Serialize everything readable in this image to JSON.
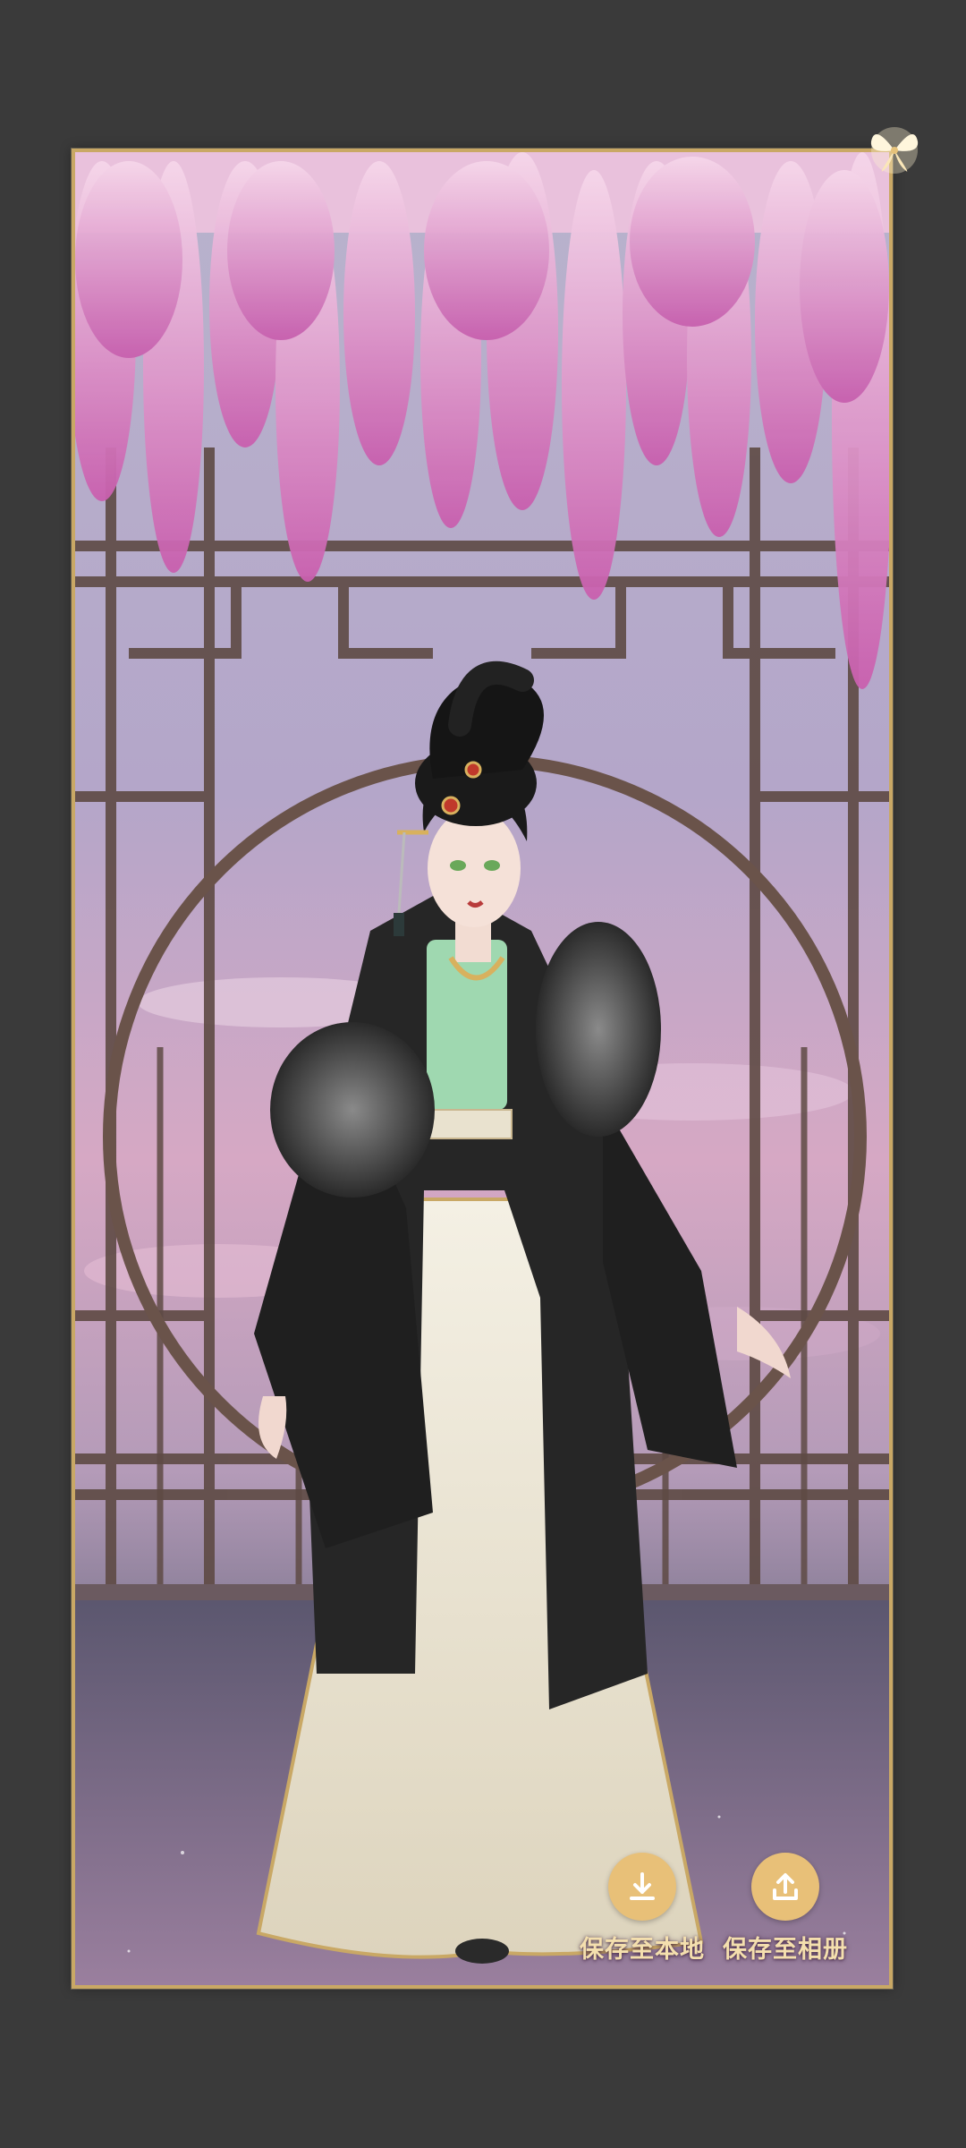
{
  "actions": {
    "save_local": {
      "label": "保存至本地",
      "icon": "download-icon"
    },
    "save_album": {
      "label": "保存至相册",
      "icon": "upload-icon"
    }
  },
  "scene": {
    "description_icon": "character-portrait",
    "corner_icon": "butterfly-icon"
  },
  "colors": {
    "background": "#3a3a3a",
    "frame_border": "#c9a865",
    "button_fill": "#e8c078",
    "button_label": "#f4dfae"
  }
}
